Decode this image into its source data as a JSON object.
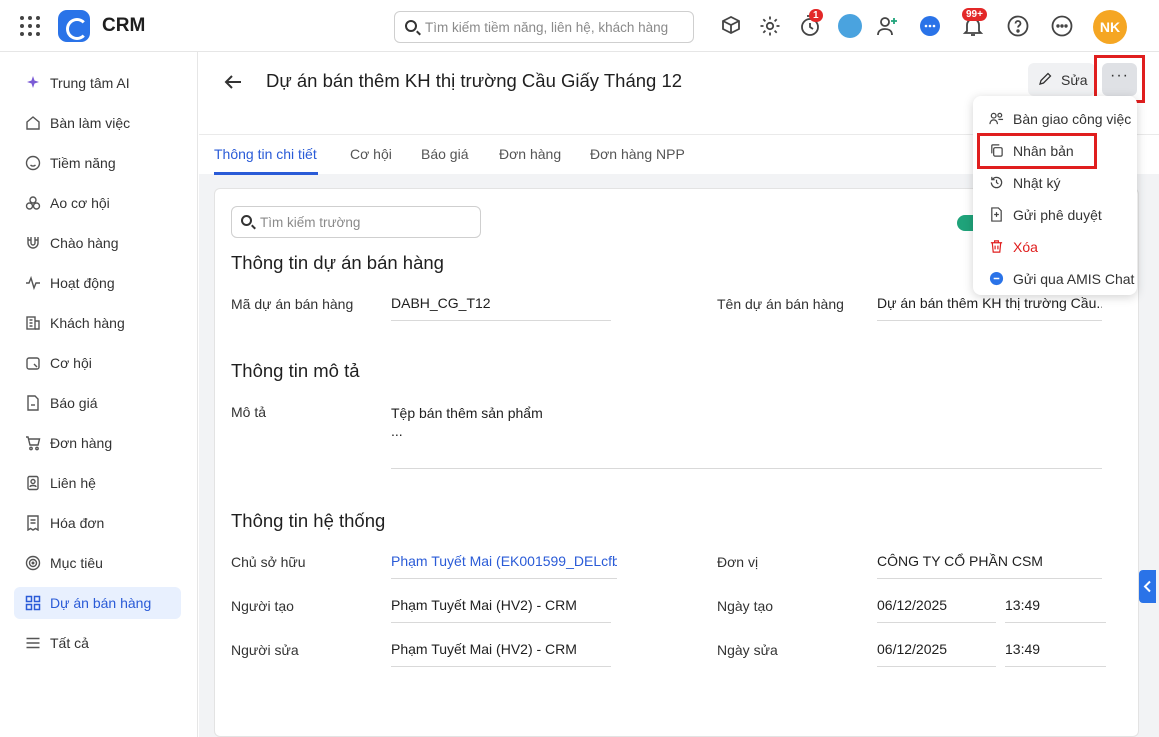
{
  "topbar": {
    "app_title": "CRM",
    "search_placeholder": "Tìm kiếm tiềm năng, liên hệ, khách hàng",
    "timer_badge": "1",
    "notification_badge": "99+",
    "avatar_initials": "NK"
  },
  "sidebar": {
    "items": [
      {
        "label": "Trung tâm AI",
        "icon": "sparkle-icon"
      },
      {
        "label": "Bàn làm việc",
        "icon": "home-icon"
      },
      {
        "label": "Tiềm năng",
        "icon": "smiley-icon"
      },
      {
        "label": "Ao cơ hội",
        "icon": "pond-icon"
      },
      {
        "label": "Chào hàng",
        "icon": "magnet-icon"
      },
      {
        "label": "Hoạt động",
        "icon": "activity-icon"
      },
      {
        "label": "Khách hàng",
        "icon": "building-icon"
      },
      {
        "label": "Cơ hội",
        "icon": "opportunity-icon"
      },
      {
        "label": "Báo giá",
        "icon": "quote-icon"
      },
      {
        "label": "Đơn hàng",
        "icon": "cart-icon"
      },
      {
        "label": "Liên hệ",
        "icon": "contact-icon"
      },
      {
        "label": "Hóa đơn",
        "icon": "invoice-icon"
      },
      {
        "label": "Mục tiêu",
        "icon": "target-icon"
      },
      {
        "label": "Dự án bán hàng",
        "icon": "grid-icon"
      },
      {
        "label": "Tất cả",
        "icon": "menu-icon"
      }
    ]
  },
  "header": {
    "title": "Dự án bán thêm KH thị trường Cầu Giấy Tháng 12",
    "edit_label": "Sửa",
    "more_label": "···"
  },
  "tabs": [
    "Thông tin chi tiết",
    "Cơ hội",
    "Báo giá",
    "Đơn hàng",
    "Đơn hàng NPP"
  ],
  "form": {
    "field_search_placeholder": "Tìm kiếm trường",
    "section_sales": "Thông tin dự án bán hàng",
    "code_label": "Mã dự án bán hàng",
    "code_value": "DABH_CG_T12",
    "name_label": "Tên dự án bán hàng",
    "name_value": "Dự án bán thêm KH thị trường Cầu...",
    "section_desc": "Thông tin mô tả",
    "desc_label": "Mô tả",
    "desc_line1": "Tệp bán thêm sản phẩm",
    "desc_line2": "...",
    "section_system": "Thông tin hệ thống",
    "owner_label": "Chủ sở hữu",
    "owner_value": "Phạm Tuyết Mai (EK001599_DELcfb",
    "unit_label": "Đơn vị",
    "unit_value": "CÔNG TY CỔ PHẦN CSM",
    "creator_label": "Người tạo",
    "creator_value": "Phạm Tuyết Mai (HV2) - CRM",
    "created_label": "Ngày tạo",
    "created_date": "06/12/2025",
    "created_time": "13:49",
    "editor_label": "Người sửa",
    "editor_value": "Phạm Tuyết Mai (HV2) - CRM",
    "edited_label": "Ngày sửa",
    "edited_date": "06/12/2025",
    "edited_time": "13:49"
  },
  "menu": {
    "items": [
      {
        "label": "Bàn giao công việc",
        "icon": "handover-icon"
      },
      {
        "label": "Nhân bản",
        "icon": "duplicate-icon"
      },
      {
        "label": "Nhật ký",
        "icon": "history-icon"
      },
      {
        "label": "Gửi phê duyệt",
        "icon": "approval-icon"
      },
      {
        "label": "Xóa",
        "icon": "trash-icon"
      },
      {
        "label": "Gửi qua AMIS Chat",
        "icon": "chat-icon"
      }
    ]
  },
  "colors": {
    "accent": "#2a5bd7",
    "highlight_border": "#e01e1e",
    "danger": "#e01e1e",
    "avatar": "#f5a623"
  }
}
